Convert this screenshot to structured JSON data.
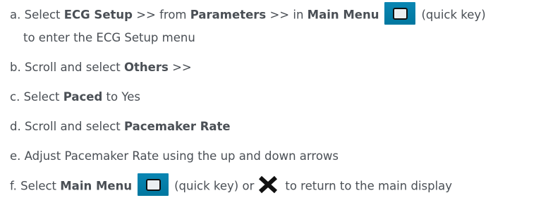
{
  "steps": [
    {
      "marker": "a.",
      "t1": "Select ",
      "b1": "ECG Setup",
      "t2": " >> from ",
      "b2": "Parameters",
      "t3": " >> in ",
      "b3": "Main Menu",
      "t4": "(quick key)",
      "line2": "to enter the ECG Setup menu"
    },
    {
      "marker": "b.",
      "t1": "Scroll and select ",
      "b1": "Others",
      "t2": " >>"
    },
    {
      "marker": "c.",
      "t1": "Select ",
      "b1": "Paced",
      "t2": " to Yes"
    },
    {
      "marker": "d.",
      "t1": "Scroll and select ",
      "b1": "Pacemaker Rate"
    },
    {
      "marker": "e.",
      "t1": "Adjust Pacemaker Rate using the up and down arrows"
    },
    {
      "marker": "f.",
      "t1": "Select ",
      "b1": "Main Menu",
      "t2": "(quick key) or",
      "t3": "to return to the main display"
    }
  ],
  "icons": {
    "quick_key": "main-menu-quick-key-icon",
    "close": "close-x-icon"
  },
  "colors": {
    "text": "#4a4f55",
    "key_blue": "#0a86b3"
  }
}
